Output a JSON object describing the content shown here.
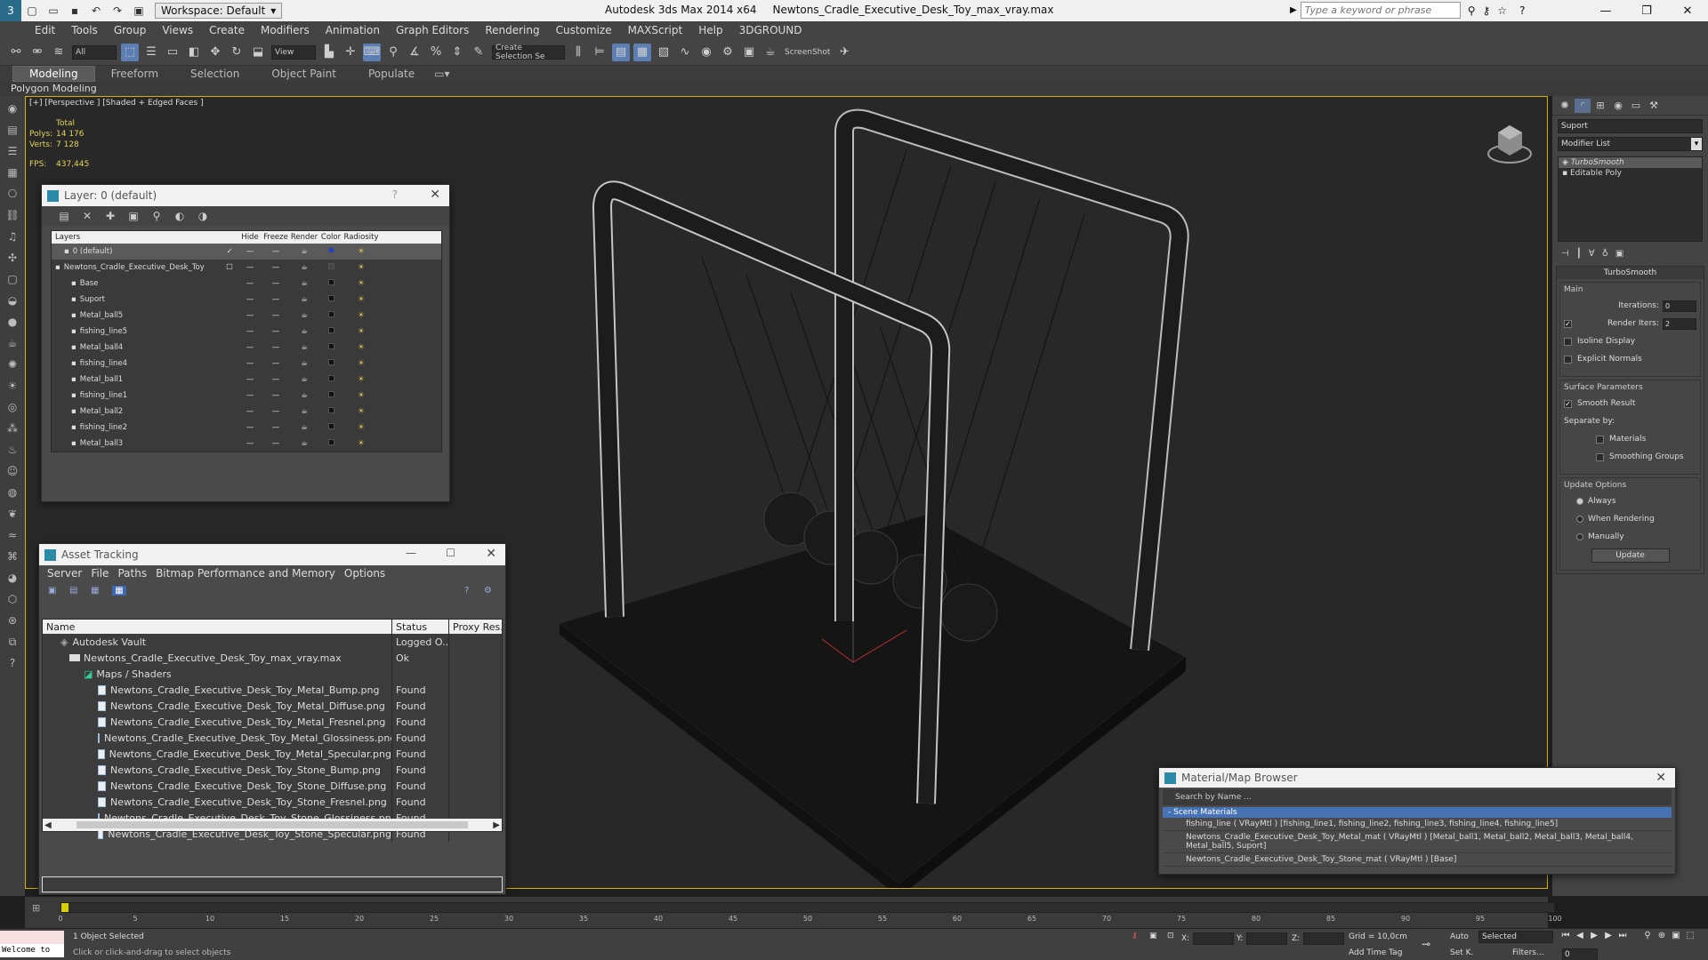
{
  "titlebar": {
    "workspace": "Workspace: Default",
    "app": "Autodesk 3ds Max  2014 x64",
    "file": "Newtons_Cradle_Executive_Desk_Toy_max_vray.max",
    "search_placeholder": "Type a keyword or phrase"
  },
  "menu": [
    "Edit",
    "Tools",
    "Group",
    "Views",
    "Create",
    "Modifiers",
    "Animation",
    "Graph Editors",
    "Rendering",
    "Customize",
    "MAXScript",
    "Help",
    "3DGROUND"
  ],
  "toolbar": {
    "filter": "All",
    "refcoord": "View",
    "selset": "Create Selection Se",
    "screenshot": "ScreenShot"
  },
  "ribbon": {
    "tabs": [
      "Modeling",
      "Freeform",
      "Selection",
      "Object Paint",
      "Populate"
    ],
    "sub": "Polygon Modeling"
  },
  "viewport": {
    "label": "[+] [Perspective ] [Shaded + Edged Faces ]",
    "stats": {
      "total": "Total",
      "polys_label": "Polys:",
      "polys": "14 176",
      "verts_label": "Verts:",
      "verts": "7 128",
      "fps_label": "FPS:",
      "fps": "437,445"
    }
  },
  "layer_panel": {
    "title": "Layer: 0 (default)",
    "help": "?",
    "cols": {
      "name": "Layers",
      "hide": "Hide",
      "freeze": "Freeze",
      "render": "Render",
      "color": "Color",
      "radiosity": "Radiosity"
    },
    "rows": [
      {
        "name": "0 (default)",
        "indent": 14,
        "swatch": "blue",
        "check": "✓"
      },
      {
        "name": "Newtons_Cradle_Executive_Desk_Toy",
        "indent": 4,
        "swatch": "gray",
        "check": "☐"
      },
      {
        "name": "Base",
        "indent": 22,
        "swatch": "black",
        "check": ""
      },
      {
        "name": "Suport",
        "indent": 22,
        "swatch": "black",
        "check": ""
      },
      {
        "name": "Metal_ball5",
        "indent": 22,
        "swatch": "black",
        "check": ""
      },
      {
        "name": "fishing_line5",
        "indent": 22,
        "swatch": "black",
        "check": ""
      },
      {
        "name": "Metal_ball4",
        "indent": 22,
        "swatch": "black",
        "check": ""
      },
      {
        "name": "fishing_line4",
        "indent": 22,
        "swatch": "black",
        "check": ""
      },
      {
        "name": "Metal_ball1",
        "indent": 22,
        "swatch": "black",
        "check": ""
      },
      {
        "name": "fishing_line1",
        "indent": 22,
        "swatch": "black",
        "check": ""
      },
      {
        "name": "Metal_ball2",
        "indent": 22,
        "swatch": "black",
        "check": ""
      },
      {
        "name": "fishing_line2",
        "indent": 22,
        "swatch": "black",
        "check": ""
      },
      {
        "name": "Metal_ball3",
        "indent": 22,
        "swatch": "black",
        "check": ""
      },
      {
        "name": "fishing_line3",
        "indent": 22,
        "swatch": "black",
        "check": ""
      }
    ]
  },
  "asset_panel": {
    "title": "Asset Tracking",
    "menu": [
      "Server",
      "File",
      "Paths",
      "Bitmap Performance and Memory",
      "Options"
    ],
    "cols": {
      "name": "Name",
      "status": "Status",
      "proxy": "Proxy Res..."
    },
    "rows": [
      {
        "name": "Autodesk Vault",
        "status": "Logged O...",
        "indent": 20,
        "icon": "vault"
      },
      {
        "name": "Newtons_Cradle_Executive_Desk_Toy_max_vray.max",
        "status": "Ok",
        "indent": 30,
        "icon": "max"
      },
      {
        "name": "Maps / Shaders",
        "status": "",
        "indent": 46,
        "icon": "folder"
      },
      {
        "name": "Newtons_Cradle_Executive_Desk_Toy_Metal_Bump.png",
        "status": "Found",
        "indent": 62,
        "icon": "file"
      },
      {
        "name": "Newtons_Cradle_Executive_Desk_Toy_Metal_Diffuse.png",
        "status": "Found",
        "indent": 62,
        "icon": "file"
      },
      {
        "name": "Newtons_Cradle_Executive_Desk_Toy_Metal_Fresnel.png",
        "status": "Found",
        "indent": 62,
        "icon": "file"
      },
      {
        "name": "Newtons_Cradle_Executive_Desk_Toy_Metal_Glossiness.png",
        "status": "Found",
        "indent": 62,
        "icon": "file"
      },
      {
        "name": "Newtons_Cradle_Executive_Desk_Toy_Metal_Specular.png",
        "status": "Found",
        "indent": 62,
        "icon": "file"
      },
      {
        "name": "Newtons_Cradle_Executive_Desk_Toy_Stone_Bump.png",
        "status": "Found",
        "indent": 62,
        "icon": "file"
      },
      {
        "name": "Newtons_Cradle_Executive_Desk_Toy_Stone_Diffuse.png",
        "status": "Found",
        "indent": 62,
        "icon": "file"
      },
      {
        "name": "Newtons_Cradle_Executive_Desk_Toy_Stone_Fresnel.png",
        "status": "Found",
        "indent": 62,
        "icon": "file"
      },
      {
        "name": "Newtons_Cradle_Executive_Desk_Toy_Stone_Glossiness.png",
        "status": "Found",
        "indent": 62,
        "icon": "file"
      },
      {
        "name": "Newtons_Cradle_Executive_Desk_Toy_Stone_Specular.png",
        "status": "Found",
        "indent": 62,
        "icon": "file"
      }
    ]
  },
  "material_browser": {
    "title": "Material/Map Browser",
    "search": "Search by Name ...",
    "section": "- Scene Materials",
    "rows": [
      "fishing_line ( VRayMtl ) [fishing_line1, fishing_line2, fishing_line3, fishing_line4, fishing_line5]",
      "Newtons_Cradle_Executive_Desk_Toy_Metal_mat ( VRayMtl ) [Metal_ball1, Metal_ball2, Metal_ball3, Metal_ball4, Metal_ball5, Suport]",
      "Newtons_Cradle_Executive_Desk_Toy_Stone_mat ( VRayMtl ) [Base]"
    ]
  },
  "command_panel": {
    "object_name": "Suport",
    "modifier_list": "Modifier List",
    "stack": [
      "TurboSmooth",
      "Editable Poly"
    ],
    "rollout": "TurboSmooth",
    "main": "Main",
    "iterations_label": "Iterations:",
    "iterations": "0",
    "render_iters_label": "Render Iters:",
    "render_iters": "2",
    "isoline": "Isoline Display",
    "explicit": "Explicit Normals",
    "surface": "Surface Parameters",
    "smooth": "Smooth Result",
    "separate": "Separate by:",
    "materials": "Materials",
    "smoothing_groups": "Smoothing Groups",
    "update_options": "Update Options",
    "always": "Always",
    "when_rendering": "When Rendering",
    "manually": "Manually",
    "update_btn": "Update"
  },
  "timeline": {
    "ticks": [
      0,
      5,
      10,
      15,
      20,
      25,
      30,
      35,
      40,
      45,
      50,
      55,
      60,
      65,
      70,
      75,
      80,
      85,
      90,
      95,
      100
    ],
    "position": "0 / 100"
  },
  "status": {
    "listener": "Welcome to",
    "msg1": "1 Object Selected",
    "msg2": "Click or click-and-drag to select objects",
    "x": "X:",
    "y": "Y:",
    "z": "Z:",
    "grid": "Grid = 10,0cm",
    "add_time_tag": "Add Time Tag",
    "auto": "Auto",
    "set_k": "Set K.",
    "selected": "Selected",
    "filters": "Filters...",
    "frame": "0"
  }
}
